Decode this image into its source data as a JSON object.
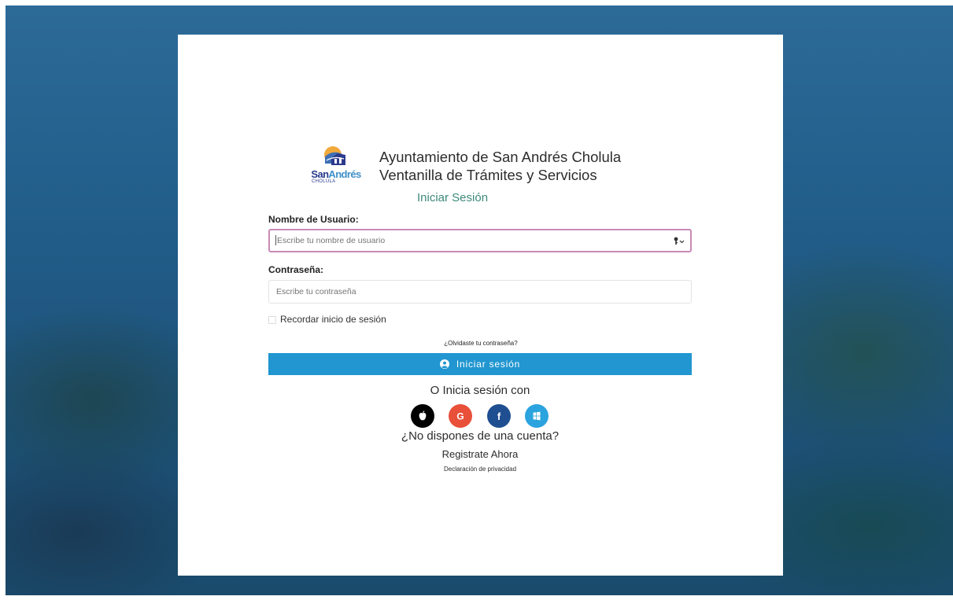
{
  "header": {
    "logo_word_san": "San",
    "logo_word_andres": "Andrés",
    "logo_subtext": "CHOLULA",
    "title_line1": "Ayuntamiento de San Andrés Cholula",
    "title_line2": "Ventanilla de Trámites y Servicios",
    "subtitle": "Iniciar Sesión"
  },
  "form": {
    "username_label": "Nombre de Usuario:",
    "username_placeholder": "Escribe tu nombre de usuario",
    "username_value": "",
    "password_label": "Contraseña:",
    "password_placeholder": "Escribe tu contraseña",
    "password_value": "",
    "remember_label": "Recordar inicio de sesión",
    "remember_checked": false,
    "forgot_link": "¿Olvidaste tu contraseña?",
    "login_button": "Iniciar sesión"
  },
  "social": {
    "title": "O Inicia sesión con",
    "providers": [
      {
        "name": "apple",
        "icon": "apple-icon",
        "color": "#000000",
        "glyph": ""
      },
      {
        "name": "google",
        "icon": "google-icon",
        "color": "#e8503a",
        "glyph": "G"
      },
      {
        "name": "facebook",
        "icon": "facebook-icon",
        "color": "#1f4f91",
        "glyph": "f"
      },
      {
        "name": "microsoft",
        "icon": "windows-icon",
        "color": "#2aa3de",
        "glyph": ""
      }
    ]
  },
  "footer": {
    "no_account": "¿No dispones de una cuenta?",
    "register_link": "Registrate Ahora",
    "privacy_link": "Declaración de privacidad"
  },
  "colors": {
    "primary_button": "#2196d0",
    "subtitle_accent": "#3d8a7a",
    "focus_border": "#c98ab8",
    "background": "#215c88"
  }
}
